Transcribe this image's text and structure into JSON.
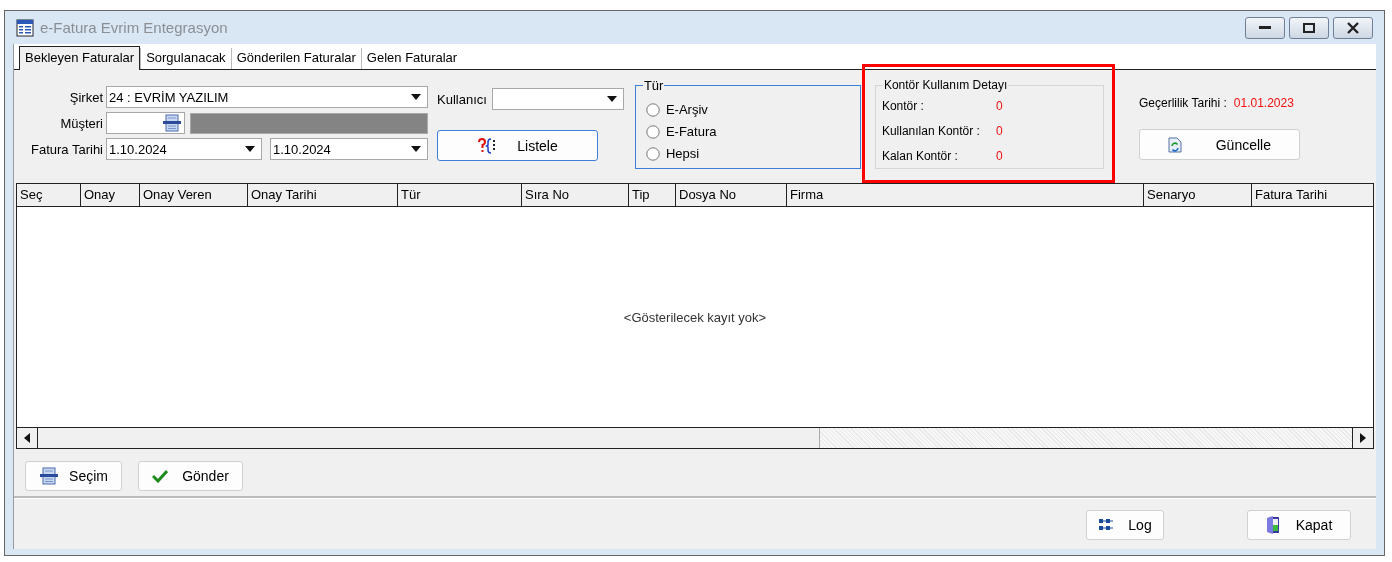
{
  "window": {
    "title": "e-Fatura Evrim Entegrasyon"
  },
  "tabs": [
    {
      "label": "Bekleyen Faturalar",
      "selected": true
    },
    {
      "label": "Sorgulanacak",
      "selected": false
    },
    {
      "label": "Gönderilen Faturalar",
      "selected": false
    },
    {
      "label": "Gelen Faturalar",
      "selected": false
    }
  ],
  "filters": {
    "company": {
      "label": "Şirket",
      "value": "24 : EVRİM YAZILIM"
    },
    "customer": {
      "label": "Müşteri"
    },
    "invoice_date": {
      "label": "Fatura Tarihi",
      "from": "1.10.2024",
      "to": "1.10.2024"
    },
    "user": {
      "label": "Kullanıcı"
    }
  },
  "list_button": "Listele",
  "type_group": {
    "title": "Tür",
    "options": [
      {
        "label": "E-Arşiv",
        "selected": false
      },
      {
        "label": "E-Fatura",
        "selected": false
      },
      {
        "label": "Hepsi",
        "selected": false
      }
    ]
  },
  "credit_group": {
    "title": "Kontör Kullanım Detayı",
    "highlighted": true,
    "rows": [
      {
        "label": "Kontör :",
        "value": "0"
      },
      {
        "label": "Kullanılan Kontör :",
        "value": "0"
      },
      {
        "label": "Kalan Kontör :",
        "value": "0"
      }
    ]
  },
  "validity": {
    "label": "Geçerlilik Tarihi :",
    "value": "01.01.2023"
  },
  "update_button": "Güncelle",
  "table": {
    "columns": [
      "Seç",
      "Onay",
      "Onay Veren",
      "Onay Tarihi",
      "Tür",
      "Sıra No",
      "Tip",
      "Dosya No",
      "Firma",
      "Senaryo",
      "Fatura Tarihi"
    ],
    "empty_message": "<Gösterilecek kayıt yok>"
  },
  "action_buttons": [
    "Seçim",
    "Gönder"
  ],
  "footer_buttons": [
    "Log",
    "Kapat"
  ]
}
